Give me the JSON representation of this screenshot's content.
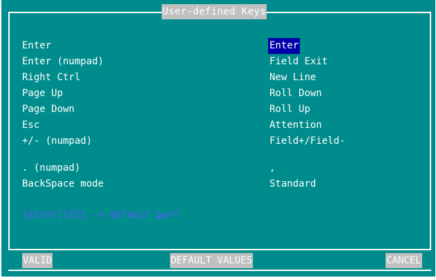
{
  "dialog": {
    "title": "User-defined Keys"
  },
  "rows": [
    {
      "label": "Enter",
      "value": "Enter",
      "selected": true
    },
    {
      "label": "Enter (numpad)",
      "value": "Field Exit"
    },
    {
      "label": "Right Ctrl",
      "value": "New Line"
    },
    {
      "label": "Page Up",
      "value": "Roll Down"
    },
    {
      "label": "Page Down",
      "value": "Roll Up"
    },
    {
      "label": "Esc",
      "value": "Attention"
    },
    {
      "label": "+/- (numpad)",
      "value": "Field+/Field-"
    },
    {
      "label": ". (numpad)",
      "value": ","
    },
    {
      "label": "BackSpace mode",
      "value": "Standard"
    }
  ],
  "hint": "[AltGr][F2] -> default port",
  "buttons": {
    "valid": "VALID",
    "default_values": "DEFAULT VALUES",
    "cancel": "CANCEL"
  },
  "colors": {
    "background": "#008c8c",
    "text": "#ffffff",
    "selection": "#0000a8",
    "hint": "#5a5aff",
    "button_bg": "#c0c0c0"
  }
}
